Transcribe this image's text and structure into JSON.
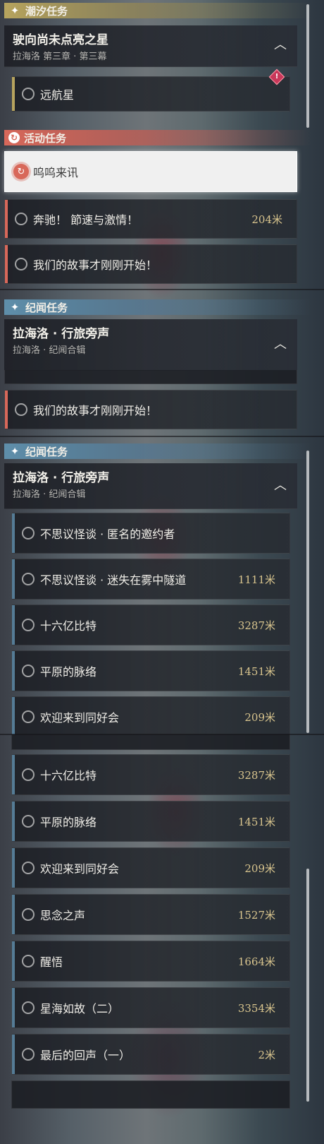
{
  "categories": {
    "tide": "潮汐任务",
    "event": "活动任务",
    "story": "纪闻任务",
    "story2": "纪闻任务"
  },
  "groups": {
    "tide": {
      "title": "驶向尚未点亮之星",
      "subtitle": "拉海洛 第三章 · 第三幕"
    },
    "story": {
      "title": "拉海洛 · 行旅旁声",
      "subtitle": "拉海洛 · 纪闻合辑"
    },
    "story2": {
      "title": "拉海洛 · 行旅旁声",
      "subtitle": "拉海洛 · 纪闻合辑"
    }
  },
  "tide_quests": [
    {
      "name": "远航星",
      "distance": ""
    }
  ],
  "event_quests": [
    {
      "name": "呜呜来讯",
      "distance": "",
      "selected": true
    },
    {
      "name": "奔驰！ 節速与激情！",
      "distance": "204米"
    },
    {
      "name": "我们的故事才刚刚开始！",
      "distance": ""
    }
  ],
  "event_quests_repeat": [
    {
      "name": "我们的故事才刚刚开始！",
      "distance": ""
    }
  ],
  "story_quests_a": [
    {
      "name": "不思议怪谈 · 匿名的邀约者",
      "distance": ""
    },
    {
      "name": "不思议怪谈 · 迷失在雾中隧道",
      "distance": "1111米"
    },
    {
      "name": "十六亿比特",
      "distance": "3287米"
    },
    {
      "name": "平原的脉络",
      "distance": "1451米"
    },
    {
      "name": "欢迎来到同好会",
      "distance": "209米"
    }
  ],
  "story_quests_b": [
    {
      "name": "十六亿比特",
      "distance": "3287米"
    },
    {
      "name": "平原的脉络",
      "distance": "1451米"
    },
    {
      "name": "欢迎来到同好会",
      "distance": "209米"
    },
    {
      "name": "思念之声",
      "distance": "1527米"
    },
    {
      "name": "醒悟",
      "distance": "1664米"
    },
    {
      "name": "星海如故（二）",
      "distance": "3354米"
    },
    {
      "name": "最后的回声（一）",
      "distance": "2米"
    }
  ]
}
